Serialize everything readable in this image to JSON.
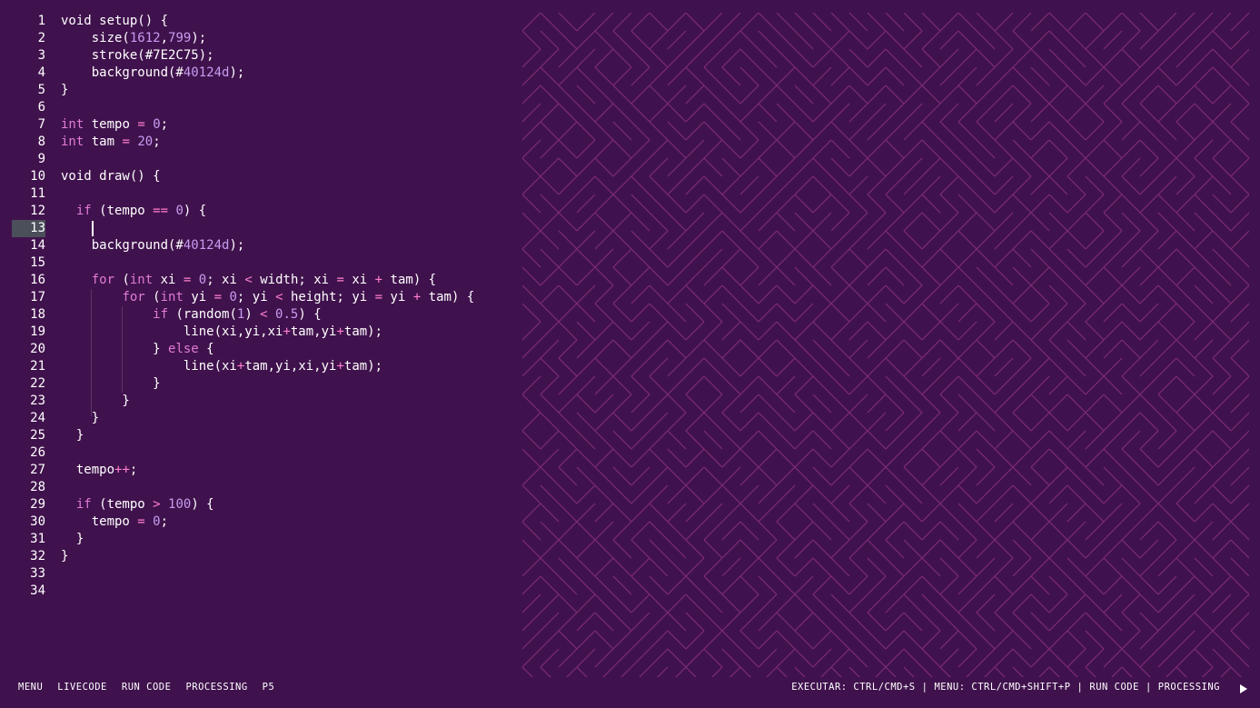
{
  "editor": {
    "active_line": 13,
    "lines": [
      [
        [
          "void setup() {",
          ""
        ]
      ],
      [
        [
          "    size(",
          ""
        ],
        [
          "1612",
          "num"
        ],
        [
          ",",
          ""
        ],
        [
          "799",
          "num"
        ],
        [
          ");",
          ""
        ]
      ],
      [
        [
          "    stroke(#7E2C75);",
          ""
        ]
      ],
      [
        [
          "    background(#",
          ""
        ],
        [
          "40124d",
          "num"
        ],
        [
          ");",
          ""
        ]
      ],
      [
        [
          "}",
          ""
        ]
      ],
      [],
      [
        [
          "int",
          "kw"
        ],
        [
          " tempo ",
          ""
        ],
        [
          "=",
          "op"
        ],
        [
          " ",
          ""
        ],
        [
          "0",
          "num"
        ],
        [
          ";",
          ""
        ]
      ],
      [
        [
          "int",
          "kw"
        ],
        [
          " tam ",
          ""
        ],
        [
          "=",
          "op"
        ],
        [
          " ",
          ""
        ],
        [
          "20",
          "num"
        ],
        [
          ";",
          ""
        ]
      ],
      [],
      [
        [
          "void draw() {",
          ""
        ]
      ],
      [],
      [
        [
          "  ",
          ""
        ],
        [
          "if",
          "kw"
        ],
        [
          " (tempo ",
          ""
        ],
        [
          "==",
          "op"
        ],
        [
          " ",
          ""
        ],
        [
          "0",
          "num"
        ],
        [
          ") {",
          ""
        ]
      ],
      [],
      [
        [
          "    background(#",
          ""
        ],
        [
          "40124d",
          "num"
        ],
        [
          ");",
          ""
        ]
      ],
      [],
      [
        [
          "    ",
          ""
        ],
        [
          "for",
          "kw"
        ],
        [
          " (",
          ""
        ],
        [
          "int",
          "kw"
        ],
        [
          " xi ",
          ""
        ],
        [
          "=",
          "op"
        ],
        [
          " ",
          ""
        ],
        [
          "0",
          "num"
        ],
        [
          "; xi ",
          ""
        ],
        [
          "<",
          "op"
        ],
        [
          " width; xi ",
          ""
        ],
        [
          "=",
          "op"
        ],
        [
          " xi ",
          ""
        ],
        [
          "+",
          "op"
        ],
        [
          " tam) {",
          ""
        ]
      ],
      [
        [
          "        ",
          ""
        ],
        [
          "for",
          "kw"
        ],
        [
          " (",
          ""
        ],
        [
          "int",
          "kw"
        ],
        [
          " yi ",
          ""
        ],
        [
          "=",
          "op"
        ],
        [
          " ",
          ""
        ],
        [
          "0",
          "num"
        ],
        [
          "; yi ",
          ""
        ],
        [
          "<",
          "op"
        ],
        [
          " height; yi ",
          ""
        ],
        [
          "=",
          "op"
        ],
        [
          " yi ",
          ""
        ],
        [
          "+",
          "op"
        ],
        [
          " tam) {",
          ""
        ]
      ],
      [
        [
          "            ",
          ""
        ],
        [
          "if",
          "kw"
        ],
        [
          " (random(",
          ""
        ],
        [
          "1",
          "num"
        ],
        [
          ") ",
          ""
        ],
        [
          "<",
          "op"
        ],
        [
          " ",
          ""
        ],
        [
          "0.5",
          "num"
        ],
        [
          ") {",
          ""
        ]
      ],
      [
        [
          "                line(xi,yi,xi",
          ""
        ],
        [
          "+",
          "op"
        ],
        [
          "tam,yi",
          ""
        ],
        [
          "+",
          "op"
        ],
        [
          "tam);",
          ""
        ]
      ],
      [
        [
          "            } ",
          ""
        ],
        [
          "else",
          "kw"
        ],
        [
          " {",
          ""
        ]
      ],
      [
        [
          "                line(xi",
          ""
        ],
        [
          "+",
          "op"
        ],
        [
          "tam,yi,xi,yi",
          ""
        ],
        [
          "+",
          "op"
        ],
        [
          "tam);",
          ""
        ]
      ],
      [
        [
          "            }",
          ""
        ]
      ],
      [
        [
          "        }",
          ""
        ]
      ],
      [
        [
          "    }",
          ""
        ]
      ],
      [
        [
          "  }",
          ""
        ]
      ],
      [],
      [
        [
          "  tempo",
          ""
        ],
        [
          "++",
          "op"
        ],
        [
          ";",
          ""
        ]
      ],
      [],
      [
        [
          "  ",
          ""
        ],
        [
          "if",
          "kw"
        ],
        [
          " (tempo ",
          ""
        ],
        [
          ">",
          "op"
        ],
        [
          " ",
          ""
        ],
        [
          "100",
          "num"
        ],
        [
          ") {",
          ""
        ]
      ],
      [
        [
          "    tempo ",
          ""
        ],
        [
          "=",
          "op"
        ],
        [
          " ",
          ""
        ],
        [
          "0",
          "num"
        ],
        [
          ";",
          ""
        ]
      ],
      [
        [
          "  }",
          ""
        ]
      ],
      [
        [
          "}",
          ""
        ]
      ],
      [],
      []
    ]
  },
  "canvas": {
    "stroke": "#7E2C75",
    "background": "#40124d"
  },
  "footer": {
    "left": [
      "MENU",
      "LIVECODE",
      "RUN CODE",
      "PROCESSING",
      "P5"
    ],
    "executar": "EXECUTAR: CTRL/CMD+S",
    "menu": "MENU: CTRL/CMD+SHIFT+P",
    "run_code": "RUN CODE",
    "processing": "PROCESSING",
    "play_icon": "play-icon"
  }
}
